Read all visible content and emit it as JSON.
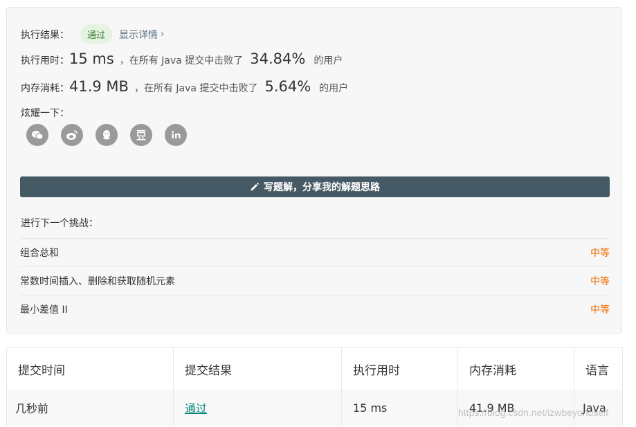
{
  "result": {
    "label": "执行结果：",
    "status": "通过",
    "detail_link": "显示详情",
    "chevron": "›"
  },
  "runtime": {
    "label": "执行用时：",
    "value": "15 ms",
    "middle": "，在所有 Java 提交中击败了",
    "percent": "34.84%",
    "suffix": "的用户"
  },
  "memory": {
    "label": "内存消耗：",
    "value": "41.9 MB",
    "middle": "，在所有 Java 提交中击败了",
    "percent": "5.64%",
    "suffix": "的用户"
  },
  "share": {
    "label": "炫耀一下：",
    "icons": [
      "wechat-icon",
      "weibo-icon",
      "qq-icon",
      "douban-icon",
      "linkedin-icon"
    ]
  },
  "write_button": {
    "label": "写题解，分享我的解题思路"
  },
  "next_challenge": {
    "title": "进行下一个挑战：",
    "items": [
      {
        "name": "组合总和",
        "difficulty": "中等"
      },
      {
        "name": "常数时间插入、删除和获取随机元素",
        "difficulty": "中等"
      },
      {
        "name": "最小差值 II",
        "difficulty": "中等"
      }
    ]
  },
  "submissions": {
    "headers": [
      "提交时间",
      "提交结果",
      "执行用时",
      "内存消耗",
      "语言"
    ],
    "rows": [
      [
        "几秒前",
        "通过",
        "15 ms",
        "41.9 MB",
        "Java"
      ]
    ]
  },
  "watermark": "https://blog.csdn.net/izwbeyondself",
  "colors": {
    "button_bg": "#455a64",
    "difficulty": "#ef6c00",
    "pass_badge_text": "#2f7d32",
    "pass_badge_bg": "#e6f3e1",
    "link_teal": "#00897b"
  }
}
